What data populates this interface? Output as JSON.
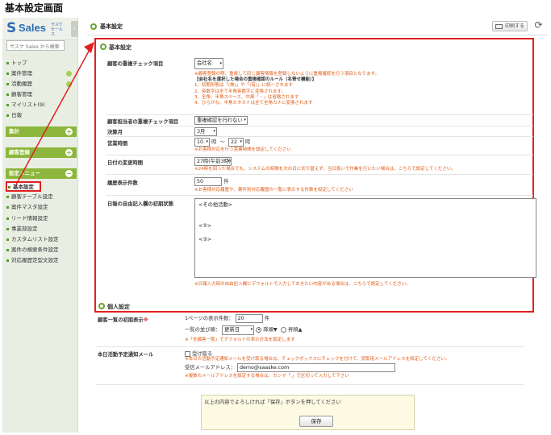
{
  "page_heading": "基本設定画面",
  "sidebar": {
    "logo_text": "Sales",
    "logo_sub": "サスケ セールス",
    "search_placeholder": "サスケ Sales から検索",
    "nav": [
      {
        "label": "トップ"
      },
      {
        "label": "案件管理"
      },
      {
        "label": "活動履歴"
      },
      {
        "label": "顧客管理"
      },
      {
        "label": "マイリスト(9)"
      },
      {
        "label": "日報"
      }
    ],
    "sections": {
      "aggregate": "集計",
      "customer_register": "顧客登録",
      "settings_menu": "設定メニュー"
    },
    "settings_items": [
      {
        "label": "基本設定"
      },
      {
        "label": "顧客テーブル設定"
      },
      {
        "label": "案件マスタ設定"
      },
      {
        "label": "リード情報設定"
      },
      {
        "label": "事業部設定"
      },
      {
        "label": "カスタムリスト設定"
      },
      {
        "label": "案件の検索条件設定"
      },
      {
        "label": "対応履歴定型文設定"
      }
    ]
  },
  "topbar": {
    "title": "基本設定",
    "print_label": "印刷する"
  },
  "basic": {
    "title": "基本設定",
    "dup_check": {
      "label": "顧客の重複チェック項目",
      "value": "会社名",
      "notes": [
        "※顧客登録の際、重複して同じ顧客情報を登録しないように重複確認を行う項目となります。",
        "【会社名を選択した場合の重複確認のルール（名寄せ機能）】",
        "1、初期形態は「(株)」や「(有)」に統一されます",
        "2、英数字は全て半角英数字に変換されます。",
        "3、全角、半角スペース、中黒「・」は省略されます",
        "4、ひらがな、半角カタカナは全て全角カナに変換されます"
      ]
    },
    "person_dup_check": {
      "label": "顧客担当者の重複チェック項目",
      "value": "重複確認を行わない"
    },
    "fiscal_month": {
      "label": "決算月",
      "value": "3月"
    },
    "business_hours": {
      "label": "営業時間",
      "start": "10",
      "hour_unit": "時",
      "tilde": "～",
      "end": "22",
      "hour_unit2": "時",
      "note": "※お客様対応を行う営業時間を設定してください"
    },
    "date_change": {
      "label": "日付の変更時間",
      "value": "27時(午前3時)",
      "note": "※24時を回った場合でも、システムの時間を次の日に切り替えず、当日扱いで作業を行いたい場合は、こちらで設定してください。"
    },
    "history_count": {
      "label": "履歴表示件数",
      "value": "50",
      "unit": "件",
      "note": "※お客様対応履歴や、案件別対応履歴の一覧に表示する件数を設定してください"
    },
    "free_text": {
      "label": "日報の自由記入欄の初期状態",
      "lines": [
        "<その他活動>",
        "",
        "",
        "<②>",
        "",
        "<③>"
      ],
      "note": "※日報入力時の自由記入欄にデフォルトで入力しておきたい内容がある場合は、こちらで設定してください。"
    }
  },
  "personal": {
    "title": "個人設定",
    "list_display": {
      "label": "顧客一覧の初期表示",
      "required_mark": "※",
      "per_page_label": "1ページの表示件数：",
      "per_page_value": "20",
      "per_page_unit": "件",
      "sort_label": "一覧の並び順：",
      "sort_value": "更新日",
      "desc_label": "降順▼",
      "asc_label": "昇順▲",
      "note": "※「全顧客一覧」でデフォルトの表示方法を設定します"
    },
    "activity_mail": {
      "label": "本日活動予定通知メール",
      "checkbox_label": "受け取る",
      "note1": "※本日の活動予定通知メールを受け取る場合は、チェックボックスにチェックを付けて、受取用メールアドレスを設定してください。",
      "address_label": "受信メールアドレス：",
      "address_value": "demo@saaske.com",
      "note2": "※複数のメールアドレスを設定する場合は、カンマ「,」で区切って入力して下さい"
    }
  },
  "save": {
    "message": "以上の内容でよろしければ「保存」ボタンを押してください",
    "button": "保存"
  },
  "colors": {
    "accent_green": "#8cb63c",
    "highlight_red": "#e02020",
    "note_orange": "#e05a14"
  }
}
